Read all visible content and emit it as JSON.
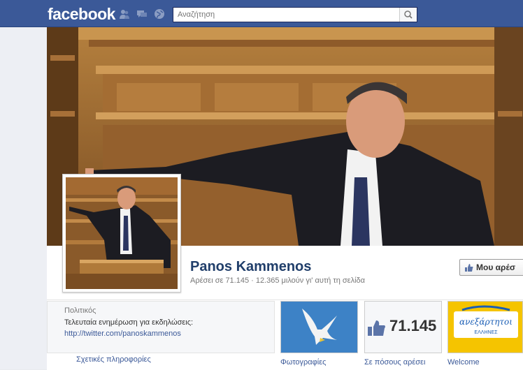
{
  "topbar": {
    "logo": "facebook",
    "icons": [
      "friend-requests-icon",
      "messages-icon",
      "notifications-globe-icon"
    ],
    "search_placeholder": "Αναζήτηση",
    "colors": {
      "brand": "#3b5998"
    }
  },
  "profile": {
    "name": "Panos Kammenos",
    "stats": "Αρέσει σε 71.145 · 12.365 μιλούν γι' αυτή τη σελίδα",
    "like_button": "Μου αρέσ"
  },
  "about": {
    "category": "Πολιτικός",
    "description_prefix": "Τελευταία ενημέρωση για εκδηλώσεις: ",
    "description_link": "http://twitter.com/panoskammenos",
    "link_label": "Σχετικές πληροφορίες"
  },
  "apps": [
    {
      "label": "Φωτογραφίες"
    },
    {
      "label": "Σε πόσους αρέσει",
      "value": "71.145"
    },
    {
      "label": "Welcome",
      "logo_text": "ανεξάρτητοι",
      "logo_sub": "ΕΛΛΗΝΕΣ"
    }
  ]
}
